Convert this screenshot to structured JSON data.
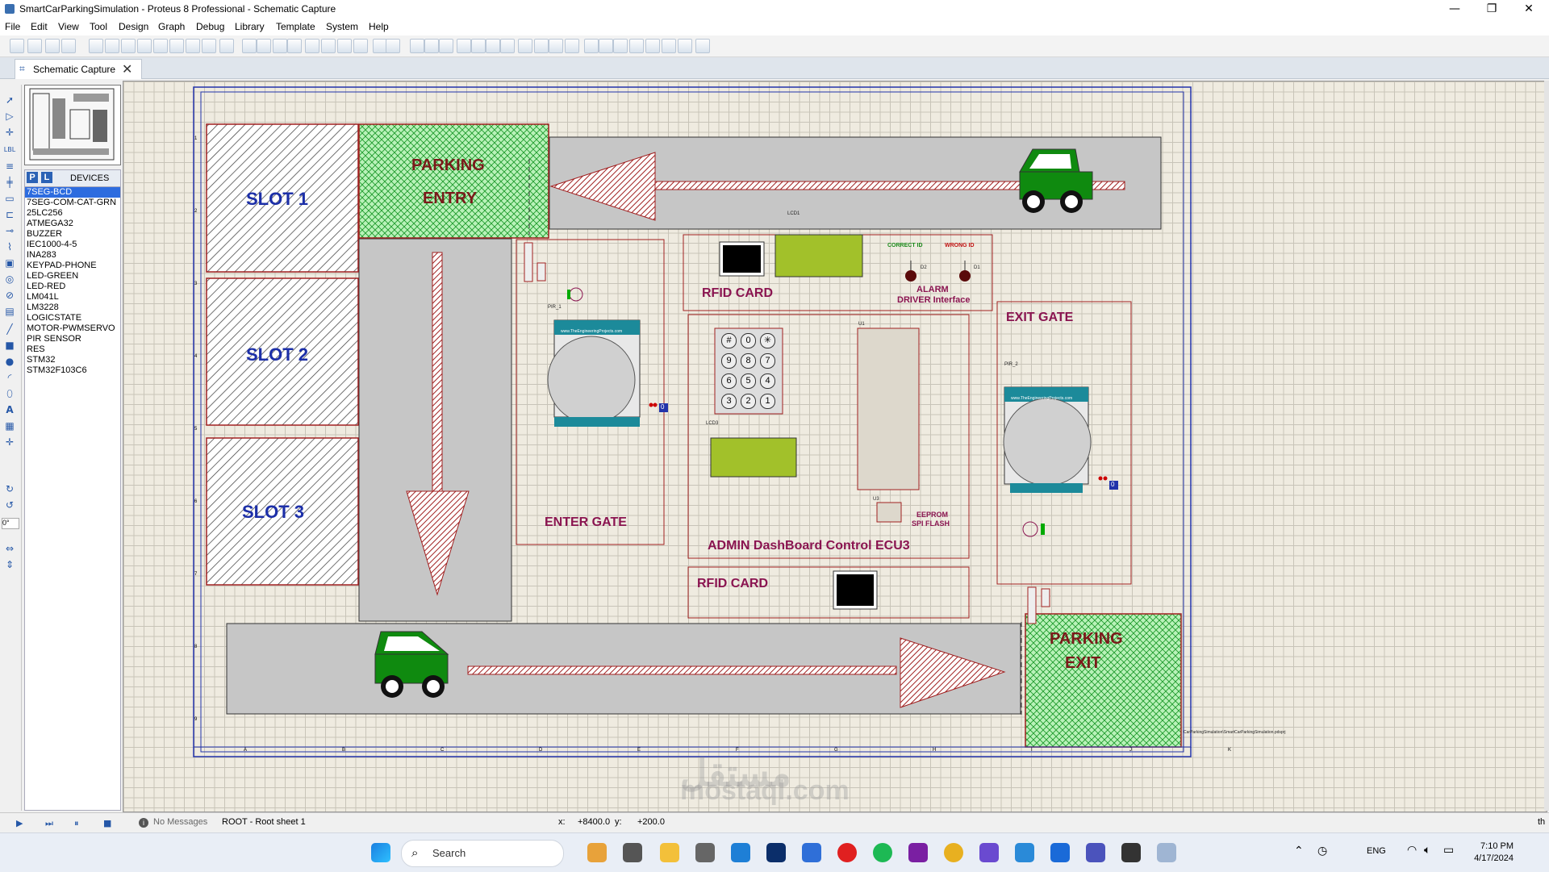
{
  "window": {
    "title": "SmartCarParkingSimulation - Proteus 8 Professional - Schematic Capture",
    "min": "—",
    "max": "❐",
    "close": "✕"
  },
  "menu": [
    "File",
    "Edit",
    "View",
    "Tool",
    "Design",
    "Graph",
    "Debug",
    "Library",
    "Template",
    "System",
    "Help"
  ],
  "tab": {
    "label": "Schematic Capture",
    "close": "✕"
  },
  "devices": {
    "pick_label": "P",
    "lib_label": "L",
    "header": "DEVICES",
    "items": [
      "7SEG-BCD",
      "7SEG-COM-CAT-GRN",
      "25LC256",
      "ATMEGA32",
      "BUZZER",
      "IEC1000-4-5",
      "INA283",
      "KEYPAD-PHONE",
      "LED-GREEN",
      "LED-RED",
      "LM041L",
      "LM3228",
      "LOGICSTATE",
      "MOTOR-PWMSERVO",
      "PIR SENSOR",
      "RES",
      "STM32",
      "STM32F103C6"
    ],
    "selected": 0
  },
  "rotation": "0°",
  "schematic": {
    "slots": [
      "SLOT 1",
      "SLOT 2",
      "SLOT 3"
    ],
    "parking_entry": [
      "PARKING",
      "ENTRY"
    ],
    "parking_exit": [
      "PARKING",
      "EXIT"
    ],
    "rfid_top": "RFID CARD",
    "rfid_bottom": "RFID CARD",
    "alarm": [
      "ALARM",
      "DRIVER Interface"
    ],
    "correct_id": "CORRECT ID",
    "wrong_id": "WRONG ID",
    "exit_gate": "EXIT GATE",
    "enter_gate": "ENTER GATE",
    "admin": "ADMIN DashBoard Control ECU3",
    "eeprom": [
      "EEPROM",
      "SPI FLASH"
    ],
    "lcd1": "LCD1",
    "lcd3": "LCD3",
    "u1": "U1",
    "u3": "U3",
    "pir1": "PIR_1",
    "pir2": "PIR_2",
    "d1": "D1",
    "d2": "D2",
    "pir_site": "www.TheEngineeringProjects.com",
    "logic_zero": "0",
    "keypad": [
      "#",
      "0",
      "✳",
      "9",
      "8",
      "7",
      "6",
      "5",
      "4",
      "3",
      "2",
      "1"
    ],
    "file_path": "CarParkingSimulation\\SmartCarParkingSimulation.pdsprj",
    "col_labels": [
      "A",
      "B",
      "C",
      "D",
      "E",
      "F",
      "G",
      "H",
      "I",
      "J",
      "K"
    ],
    "row_labels": [
      "1",
      "2",
      "3",
      "4",
      "5",
      "6",
      "7",
      "8",
      "9"
    ]
  },
  "status": {
    "messages": "No Messages",
    "sheet": "ROOT - Root sheet 1",
    "x_label": "x:",
    "x_value": "+8400.0",
    "y_label": "y:",
    "y_value": "+200.0",
    "unit": "th"
  },
  "taskbar": {
    "search": "Search",
    "lang": "ENG",
    "time": "7:10 PM",
    "date": "4/17/2024"
  },
  "watermark": [
    "مستقل",
    "mostaql.com"
  ],
  "colors": {
    "road": "#c6c6c6",
    "car": "#0f8a0f",
    "lcd": "#a2c12a",
    "label": "#8a1450",
    "slot_text": "#1c2fa8"
  }
}
